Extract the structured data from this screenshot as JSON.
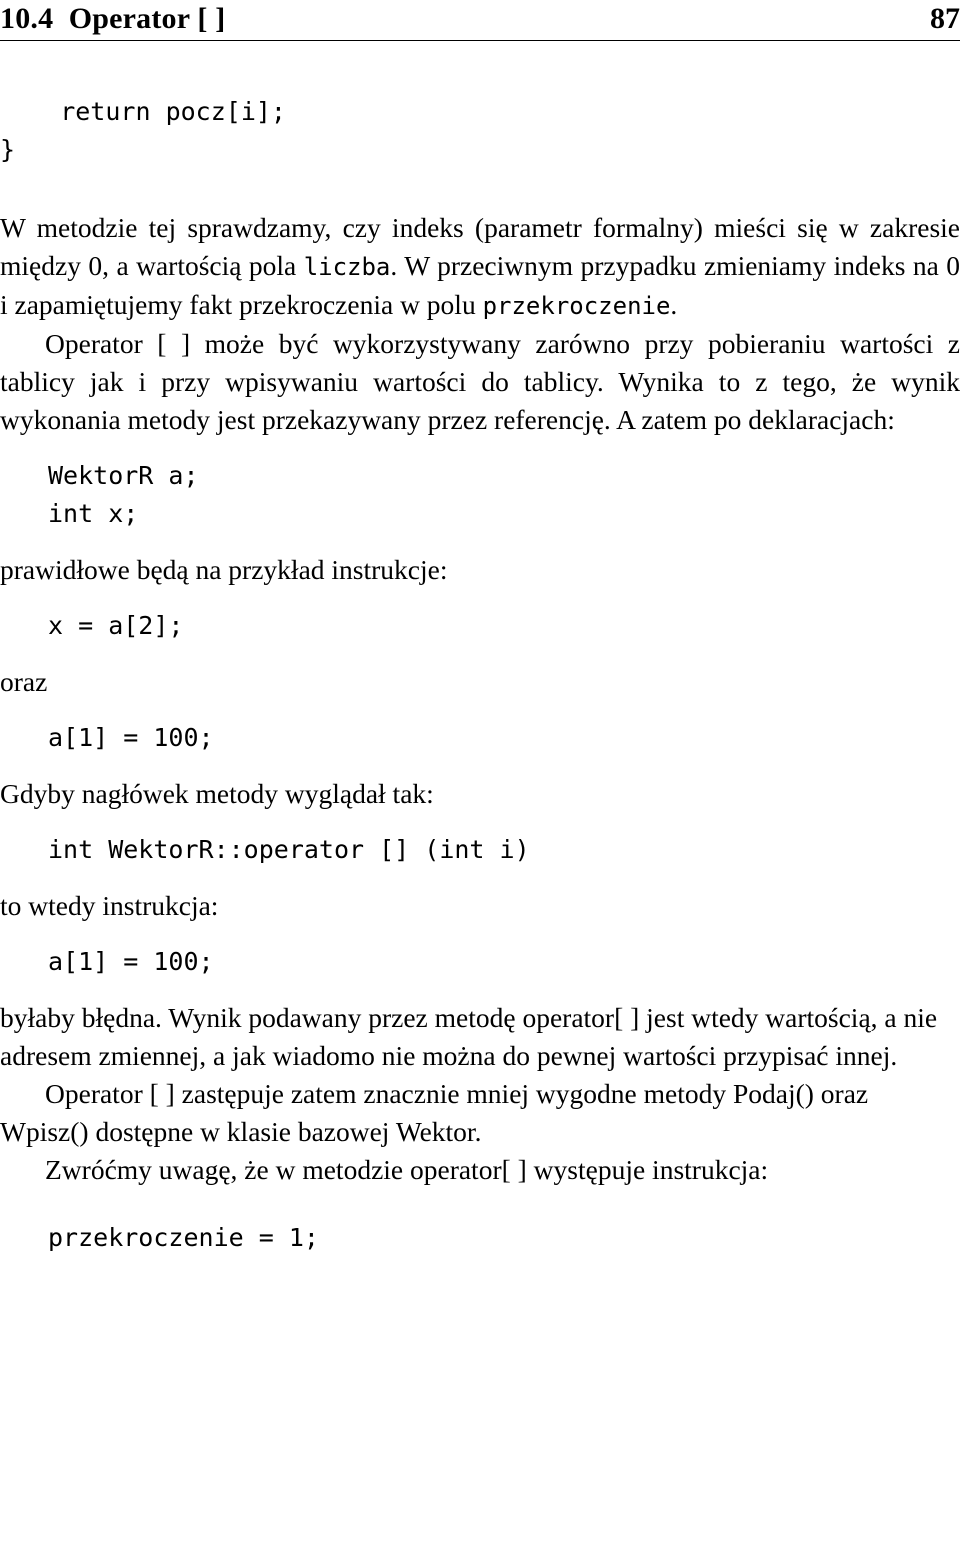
{
  "header": {
    "chapter": "10.4  Operator [ ]",
    "page_number": "87"
  },
  "content": {
    "code_return_block": "    return pocz[i];\n}",
    "para_1": "W metodzie tej sprawdzamy, czy indeks (parametr formalny) mieści się w zakresie między 0, a wartością pola liczba. W przeciwnym przypadku zmieniamy indeks na 0 i zapamiętujemy fakt przekroczenia w polu przekroczenie.",
    "para_1_code_1": "liczba",
    "para_1_code_2": "przekroczenie",
    "para_2": "Operator [ ] może być wykorzystywany zarówno przy pobieraniu wartości z tablicy jak i przy wpisywaniu wartości do tablicy. Wynika to z tego, że wynik wykonania metody jest przekazywany przez referencję. A zatem po deklaracjach:",
    "code_declarations": "WektorR a;\nint x;",
    "para_3": "prawidłowe będą na przykład instrukcje:",
    "code_read": "x = a[2];",
    "para_4": "oraz",
    "code_write": "a[1] = 100;",
    "para_5": "Gdyby nagłówek metody wyglądał tak:",
    "code_header": "int WektorR::operator [] (int i)",
    "para_6": "to wtedy instrukcja:",
    "code_write_2": "a[1] = 100;",
    "para_7": "byłaby błędna. Wynik podawany przez metodę operator[ ] jest wtedy wartością, a nie adresem zmiennej, a jak wiadomo nie można do pewnej wartości przypisać innej.",
    "para_8": "Operator [ ] zastępuje zatem znacznie mniej wygodne metody Podaj() oraz Wpisz() dostępne w klasie bazowej Wektor.",
    "para_9": "Zwróćmy uwagę, że w metodzie operator[ ] występuje instrukcja:",
    "code_final": "przekroczenie = 1;"
  }
}
